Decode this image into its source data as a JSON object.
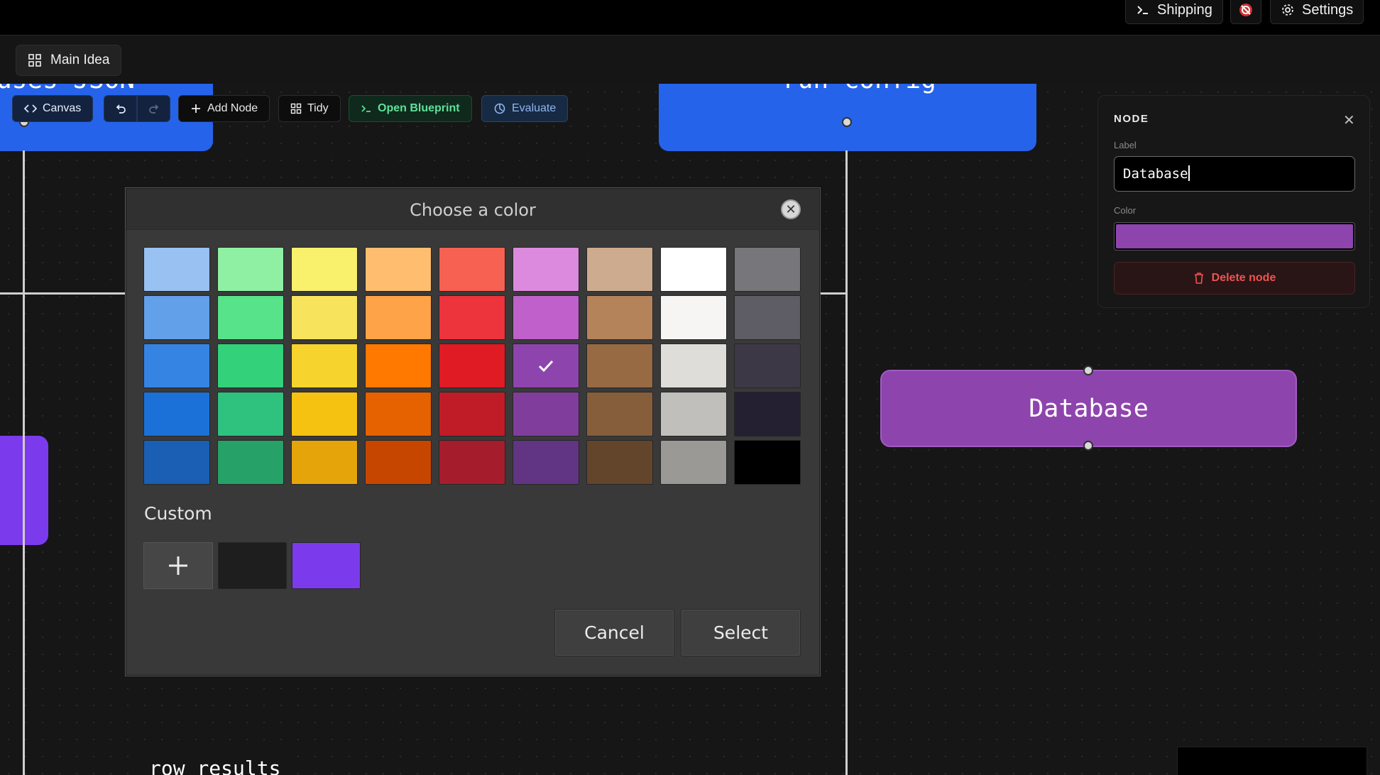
{
  "topbar": {
    "shipping_label": "Shipping",
    "settings_label": "Settings",
    "icons": [
      "terminal-icon",
      "stop-icon",
      "gear-icon"
    ]
  },
  "tabs": {
    "main_label": "Main Idea"
  },
  "nodes": {
    "left_partial_text": "uses JSON",
    "center_partial_text": "run config",
    "bottom_partial_text": "row results",
    "database_label": "Database"
  },
  "toolbar": {
    "canvas_label": "Canvas",
    "add_node_label": "Add Node",
    "tidy_label": "Tidy",
    "open_blueprint_label": "Open Blueprint",
    "evaluate_label": "Evaluate"
  },
  "panel": {
    "title": "NODE",
    "close_glyph": "✕",
    "label_caption": "Label",
    "label_value": "Database",
    "color_caption": "Color",
    "color_value": "#8e44ad",
    "delete_label": "Delete node"
  },
  "dialog": {
    "title": "Choose a color",
    "custom_label": "Custom",
    "cancel_label": "Cancel",
    "select_label": "Select",
    "selected_swatch": "#8e44ad",
    "swatches": [
      [
        "#99c1f1",
        "#8ff0a4",
        "#f9f06b",
        "#ffbe6f",
        "#f66151",
        "#dc8add",
        "#cdab8f",
        "#ffffff",
        "#77767b"
      ],
      [
        "#62a0ea",
        "#57e389",
        "#f8e45c",
        "#ffa348",
        "#ed333b",
        "#c061cb",
        "#b5835a",
        "#f6f5f4",
        "#5e5c64"
      ],
      [
        "#3584e4",
        "#33d17a",
        "#f6d32d",
        "#ff7800",
        "#e01b24",
        "#8e44ad",
        "#986a44",
        "#deddda",
        "#3d3846"
      ],
      [
        "#1c71d8",
        "#2ec27e",
        "#f5c211",
        "#e66100",
        "#c01c28",
        "#813d9c",
        "#865e3c",
        "#c0bfbc",
        "#241f31"
      ],
      [
        "#1a5fb4",
        "#26a269",
        "#e5a50a",
        "#c64600",
        "#a51d2d",
        "#613583",
        "#63452c",
        "#9a9996",
        "#000000"
      ]
    ],
    "custom_swatches": [
      "#1e1e1e",
      "#7c3aed"
    ]
  },
  "colors": {
    "node_blue": "#2563eb",
    "node_purple": "#8e44ad",
    "node_violet": "#7c3aed",
    "danger": "#ef5350"
  }
}
